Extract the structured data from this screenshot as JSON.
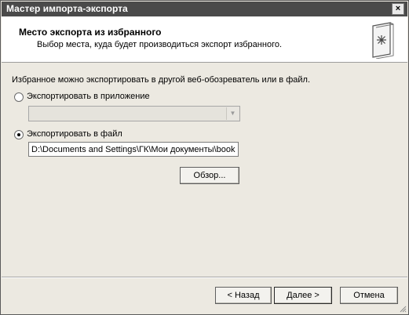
{
  "window": {
    "title": "Мастер импорта-экспорта",
    "close_label": "×"
  },
  "header": {
    "title": "Место экспорта из избранного",
    "subtitle": "Выбор места, куда будет производиться экспорт избранного.",
    "icon": "favorites-folder-icon"
  },
  "content": {
    "intro": "Избранное можно экспортировать в другой веб-обозреватель или в файл.",
    "option_app": {
      "label": "Экспортировать в приложение",
      "selected": false
    },
    "app_select": {
      "value": "",
      "disabled": true
    },
    "option_file": {
      "label": "Экспортировать в файл",
      "selected": true
    },
    "file_path": "D:\\Documents and Settings\\ГК\\Мои документы\\book",
    "browse_label": "Обзор..."
  },
  "footer": {
    "back_label": "< Назад",
    "next_label": "Далее >",
    "cancel_label": "Отмена"
  }
}
